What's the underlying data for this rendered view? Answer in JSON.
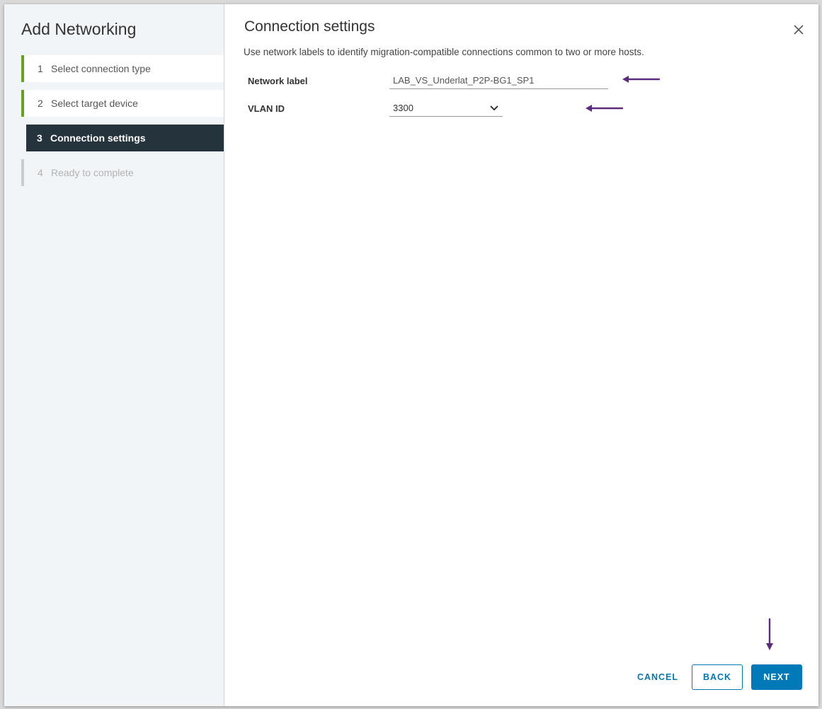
{
  "wizard": {
    "title": "Add Networking",
    "steps": [
      {
        "number": "1",
        "label": "Select connection type",
        "state": "done"
      },
      {
        "number": "2",
        "label": "Select target device",
        "state": "done"
      },
      {
        "number": "3",
        "label": "Connection settings",
        "state": "active"
      },
      {
        "number": "4",
        "label": "Ready to complete",
        "state": "pending"
      }
    ]
  },
  "page": {
    "title": "Connection settings",
    "description": "Use network labels to identify migration-compatible connections common to two or more hosts.",
    "close_icon": "close-icon"
  },
  "form": {
    "network_label": {
      "label": "Network label",
      "value": "LAB_VS_Underlat_P2P-BG1_SP1"
    },
    "vlan_id": {
      "label": "VLAN ID",
      "value": "3300",
      "icon": "chevron-down-icon"
    }
  },
  "footer": {
    "cancel_label": "CANCEL",
    "back_label": "BACK",
    "next_label": "NEXT"
  },
  "colors": {
    "accent": "#0079b8",
    "step_done": "#62a420",
    "step_active_bg": "#25333d",
    "annotation_arrow": "#5c2a7e"
  }
}
